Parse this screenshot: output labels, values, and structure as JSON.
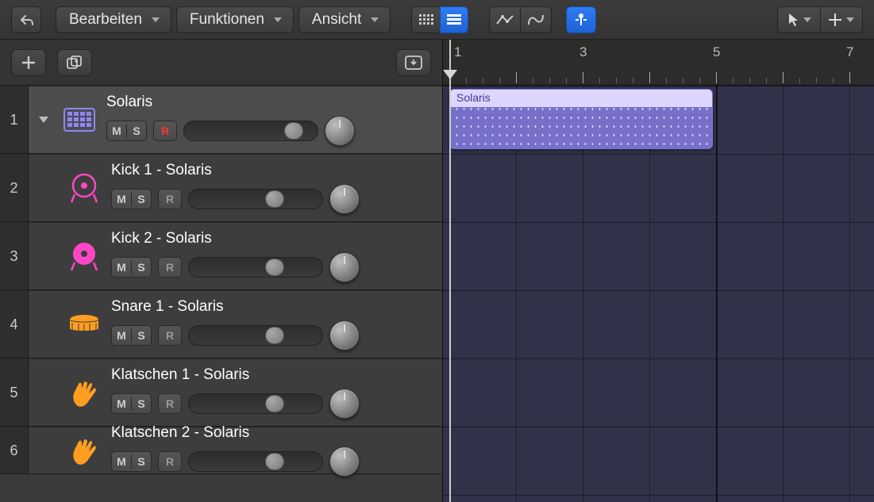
{
  "toolbar": {
    "back_icon": "back-curve-icon",
    "menus": [
      {
        "label": "Bearbeiten"
      },
      {
        "label": "Funktionen"
      },
      {
        "label": "Ansicht"
      }
    ],
    "view_toggle": {
      "grid_icon": "grid-icon",
      "list_icon": "list-icon",
      "active": "list"
    },
    "automation_icon": "automation-line-icon",
    "flex_icon": "flex-icon",
    "snap_icon": "snap-playhead-icon",
    "pointer_icon": "pointer-icon",
    "pencil_icon": "crosshair-icon"
  },
  "addbar": {
    "add_icon": "plus-icon",
    "dup_icon": "duplicate-icon",
    "catch_icon": "catch-box-icon"
  },
  "ruler": {
    "bars": [
      1,
      3,
      5,
      7
    ]
  },
  "tracks": [
    {
      "n": 1,
      "name": "Solaris",
      "main": true,
      "mute": "M",
      "solo": "S",
      "rec": "R",
      "rec_armed": true,
      "icon": "sequencer-icon",
      "icon_color": "#8f86ff"
    },
    {
      "n": 2,
      "name": "Kick 1 - Solaris",
      "mute": "M",
      "solo": "S",
      "rec": "R",
      "icon": "kick-icon",
      "icon_color": "#ff46c4"
    },
    {
      "n": 3,
      "name": "Kick 2 - Solaris",
      "mute": "M",
      "solo": "S",
      "rec": "R",
      "icon": "kick2-icon",
      "icon_color": "#ff46c4"
    },
    {
      "n": 4,
      "name": "Snare 1 - Solaris",
      "mute": "M",
      "solo": "S",
      "rec": "R",
      "icon": "snare-icon",
      "icon_color": "#ff9e1f"
    },
    {
      "n": 5,
      "name": "Klatschen 1 - Solaris",
      "mute": "M",
      "solo": "S",
      "rec": "R",
      "icon": "clap-icon",
      "icon_color": "#ff9e1f"
    },
    {
      "n": 6,
      "name": "Klatschen 2 - Solaris",
      "mute": "M",
      "solo": "S",
      "rec": "R",
      "icon": "clap-icon",
      "icon_color": "#ff9e1f"
    }
  ],
  "clip": {
    "name": "Solaris"
  }
}
